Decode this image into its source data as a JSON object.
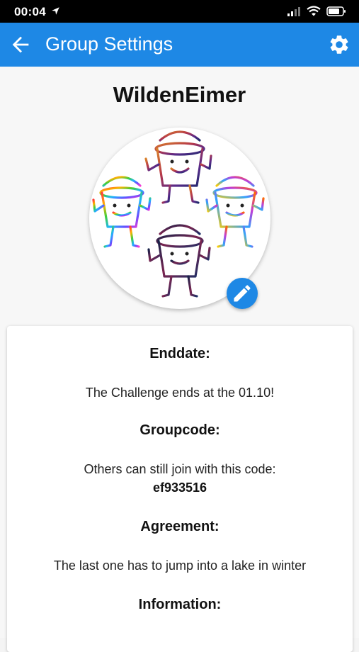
{
  "status_bar": {
    "time": "00:04"
  },
  "header": {
    "title": "Group Settings"
  },
  "icons": {
    "back": "arrow-left-icon",
    "settings": "gear-icon",
    "edit": "pencil-icon",
    "signal": "cellular-signal-icon",
    "wifi": "wifi-icon",
    "battery": "battery-icon",
    "location": "location-arrow-icon"
  },
  "colors": {
    "app_bar": "#1e88e5",
    "edit_button": "#1e88e5"
  },
  "group": {
    "name": "WildenEimer"
  },
  "sections": [
    {
      "heading": "Enddate:",
      "text": "The Challenge ends at the 01.10!"
    },
    {
      "heading": "Groupcode:",
      "text": "Others can still join with this code:",
      "code": "ef933516"
    },
    {
      "heading": "Agreement:",
      "text": "The last one has to jump into a lake in winter"
    },
    {
      "heading": "Information:"
    }
  ]
}
